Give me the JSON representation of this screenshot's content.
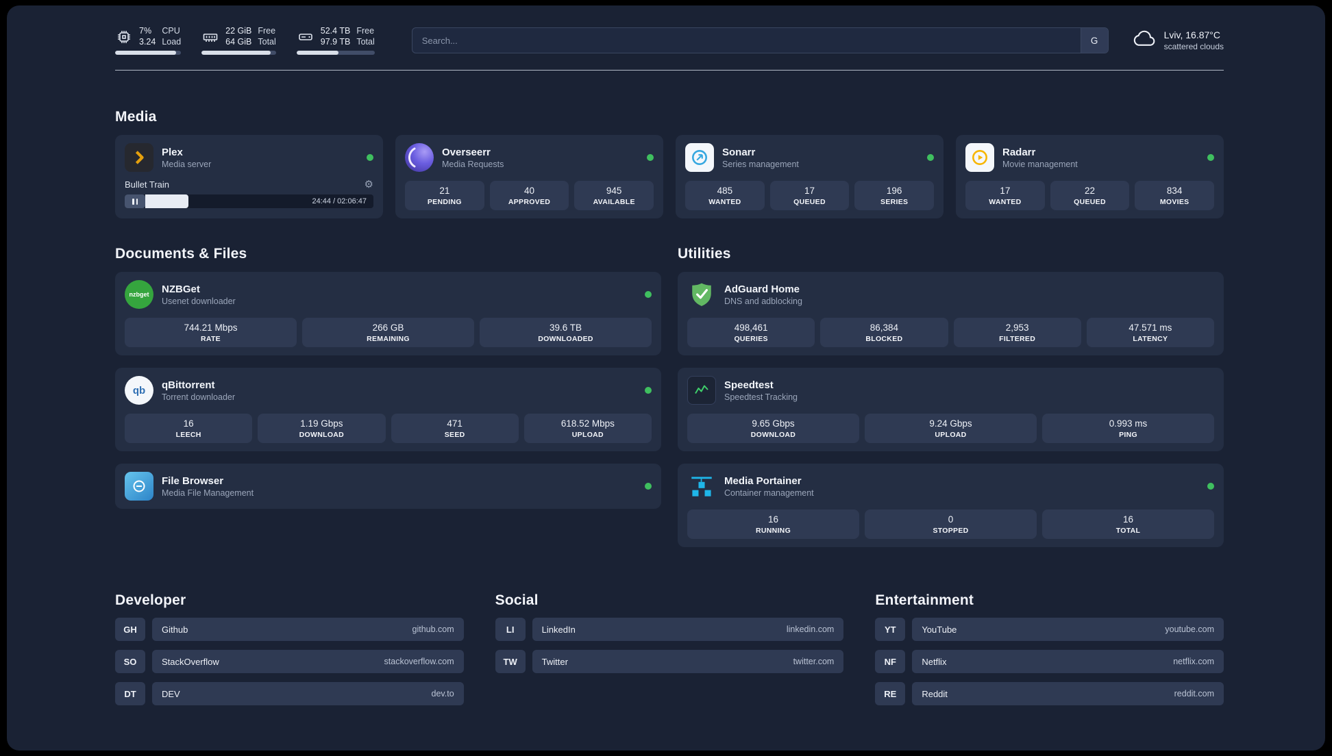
{
  "colors": {
    "status_online": "#3fbf5f",
    "plex_accent": "#e5a00d",
    "overseerr_accent": "#6a5de0",
    "sonarr_accent": "#35a7e0",
    "radarr_accent": "#f7b500",
    "adguard_accent": "#62b863",
    "speedtest_accent": "#3fd06b",
    "portainer_accent": "#1fb6e9"
  },
  "icons": {
    "gear": "⚙"
  },
  "topbar": {
    "cpu": {
      "value_top": "7%",
      "value_bottom": "3.24",
      "label_top": "CPU",
      "label_bottom": "Load",
      "bar_percent": 93
    },
    "memory": {
      "value_top": "22 GiB",
      "value_bottom": "64 GiB",
      "label_top": "Free",
      "label_bottom": "Total",
      "bar_percent": 93
    },
    "disk": {
      "value_top": "52.4 TB",
      "value_bottom": "97.9 TB",
      "label_top": "Free",
      "label_bottom": "Total",
      "bar_percent": 54
    },
    "search": {
      "placeholder": "Search...",
      "engine_label": "G"
    },
    "weather": {
      "location": "Lviv, 16.87°C",
      "description": "scattered clouds"
    }
  },
  "media": {
    "title": "Media",
    "plex": {
      "name": "Plex",
      "subtitle": "Media server",
      "player_title": "Bullet Train",
      "player_time": "24:44 / 02:06:47",
      "progress_percent": 19
    },
    "overseerr": {
      "name": "Overseerr",
      "subtitle": "Media Requests",
      "stats": [
        {
          "value": "21",
          "label": "PENDING"
        },
        {
          "value": "40",
          "label": "APPROVED"
        },
        {
          "value": "945",
          "label": "AVAILABLE"
        }
      ]
    },
    "sonarr": {
      "name": "Sonarr",
      "subtitle": "Series management",
      "stats": [
        {
          "value": "485",
          "label": "WANTED"
        },
        {
          "value": "17",
          "label": "QUEUED"
        },
        {
          "value": "196",
          "label": "SERIES"
        }
      ]
    },
    "radarr": {
      "name": "Radarr",
      "subtitle": "Movie management",
      "stats": [
        {
          "value": "17",
          "label": "WANTED"
        },
        {
          "value": "22",
          "label": "QUEUED"
        },
        {
          "value": "834",
          "label": "MOVIES"
        }
      ]
    }
  },
  "documents": {
    "title": "Documents & Files",
    "nzbget": {
      "name": "NZBGet",
      "subtitle": "Usenet downloader",
      "icon_text": "nzbget",
      "stats": [
        {
          "value": "744.21 Mbps",
          "label": "RATE"
        },
        {
          "value": "266 GB",
          "label": "REMAINING"
        },
        {
          "value": "39.6 TB",
          "label": "DOWNLOADED"
        }
      ]
    },
    "qbittorrent": {
      "name": "qBittorrent",
      "subtitle": "Torrent downloader",
      "icon_text": "qb",
      "stats": [
        {
          "value": "16",
          "label": "LEECH"
        },
        {
          "value": "1.19 Gbps",
          "label": "DOWNLOAD"
        },
        {
          "value": "471",
          "label": "SEED"
        },
        {
          "value": "618.52 Mbps",
          "label": "UPLOAD"
        }
      ]
    },
    "filebrowser": {
      "name": "File Browser",
      "subtitle": "Media File Management"
    }
  },
  "utilities": {
    "title": "Utilities",
    "adguard": {
      "name": "AdGuard Home",
      "subtitle": "DNS and adblocking",
      "stats": [
        {
          "value": "498,461",
          "label": "QUERIES"
        },
        {
          "value": "86,384",
          "label": "BLOCKED"
        },
        {
          "value": "2,953",
          "label": "FILTERED"
        },
        {
          "value": "47.571 ms",
          "label": "LATENCY"
        }
      ]
    },
    "speedtest": {
      "name": "Speedtest",
      "subtitle": "Speedtest Tracking",
      "stats": [
        {
          "value": "9.65 Gbps",
          "label": "DOWNLOAD"
        },
        {
          "value": "9.24 Gbps",
          "label": "UPLOAD"
        },
        {
          "value": "0.993 ms",
          "label": "PING"
        }
      ]
    },
    "portainer": {
      "name": "Media Portainer",
      "subtitle": "Container management",
      "stats": [
        {
          "value": "16",
          "label": "RUNNING"
        },
        {
          "value": "0",
          "label": "STOPPED"
        },
        {
          "value": "16",
          "label": "TOTAL"
        }
      ]
    }
  },
  "links": {
    "developer": {
      "title": "Developer",
      "items": [
        {
          "badge": "GH",
          "name": "Github",
          "domain": "github.com"
        },
        {
          "badge": "SO",
          "name": "StackOverflow",
          "domain": "stackoverflow.com"
        },
        {
          "badge": "DT",
          "name": "DEV",
          "domain": "dev.to"
        }
      ]
    },
    "social": {
      "title": "Social",
      "items": [
        {
          "badge": "LI",
          "name": "LinkedIn",
          "domain": "linkedin.com"
        },
        {
          "badge": "TW",
          "name": "Twitter",
          "domain": "twitter.com"
        }
      ]
    },
    "entertainment": {
      "title": "Entertainment",
      "items": [
        {
          "badge": "YT",
          "name": "YouTube",
          "domain": "youtube.com"
        },
        {
          "badge": "NF",
          "name": "Netflix",
          "domain": "netflix.com"
        },
        {
          "badge": "RE",
          "name": "Reddit",
          "domain": "reddit.com"
        }
      ]
    }
  }
}
